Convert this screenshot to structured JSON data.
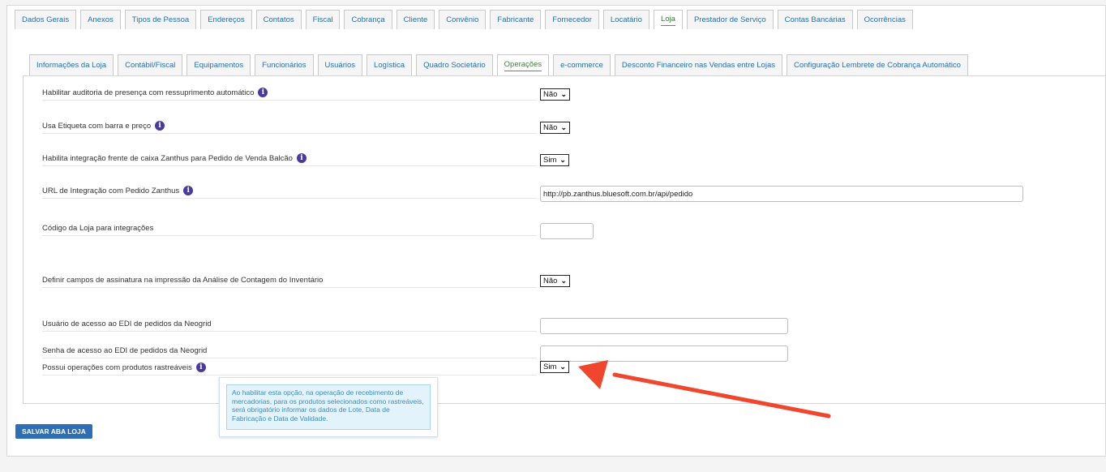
{
  "main_tabs": [
    "Dados Gerais",
    "Anexos",
    "Tipos de Pessoa",
    "Endereços",
    "Contatos",
    "Fiscal",
    "Cobrança",
    "Cliente",
    "Convênio",
    "Fabricante",
    "Fornecedor",
    "Locatário",
    "Loja",
    "Prestador de Serviço",
    "Contas Bancárias",
    "Ocorrências"
  ],
  "main_active": "Loja",
  "sub_tabs": [
    "Informações da Loja",
    "Contábil/Fiscal",
    "Equipamentos",
    "Funcionários",
    "Usuários",
    "Logística",
    "Quadro Societário",
    "Operações",
    "e-commerce",
    "Desconto Financeiro nas Vendas entre Lojas",
    "Configuração Lembrete de Cobrança Automático"
  ],
  "sub_active": "Operações",
  "fields": {
    "auditoria": {
      "label": "Habilitar auditoria de presença com ressuprimento automático",
      "value": "Não"
    },
    "etiqueta": {
      "label": "Usa Etiqueta com barra e preço",
      "value": "Não"
    },
    "zanthus": {
      "label": "Habilita integração frente de caixa Zanthus para Pedido de Venda Balcão",
      "value": "Sim"
    },
    "url_zanthus": {
      "label": "URL de Integração com Pedido Zanthus",
      "value": "http://pb.zanthus.bluesoft.com.br/api/pedido"
    },
    "codigo_loja": {
      "label": "Código da Loja para integrações",
      "value": ""
    },
    "assinatura": {
      "label": "Definir campos de assinatura na impressão da Análise de Contagem do Inventário",
      "value": "Não"
    },
    "usuario_edi": {
      "label": "Usuário de acesso ao EDI de pedidos da Neogrid",
      "value": ""
    },
    "senha_edi": {
      "label": "Senha de acesso ao EDI de pedidos da Neogrid",
      "value": ""
    },
    "rastreaveis": {
      "label": "Possui operações com produtos rastreáveis",
      "value": "Sim"
    }
  },
  "tooltip": "Ao habilitar esta opção, na operação de recebimento de mercadorias, para os produtos selecionados como rastreáveis, será obrigatório informar os dados de Lote, Data de Fabricação e Data de Validade.",
  "save_button": "SALVAR ABA LOJA",
  "colors": {
    "arrow": "#f0462d",
    "link": "#2a6fb0",
    "active_tab": "#2e8b2e",
    "button": "#2f6db5"
  }
}
